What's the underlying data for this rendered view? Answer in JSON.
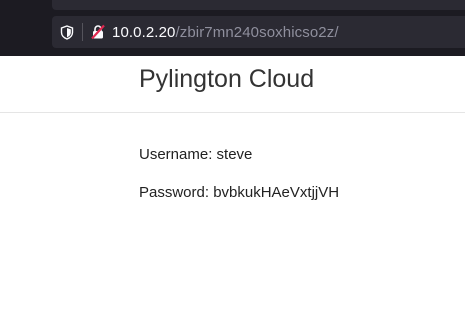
{
  "browser": {
    "url_host": "10.0.2.20",
    "url_path": "/zbir7mn240soxhicso2z/",
    "icons": {
      "tracking_protection": "shield-icon",
      "connection": "insecure-lock-icon"
    }
  },
  "site": {
    "title": "Pylington Cloud"
  },
  "credentials": {
    "username_line": "Username: steve",
    "password_line": "Password: bvbkukHAeVxtjjVH"
  },
  "colors": {
    "chrome_bg": "#1c1b22",
    "urlbar_bg": "#2b2a33",
    "insecure_red": "#e22850"
  }
}
